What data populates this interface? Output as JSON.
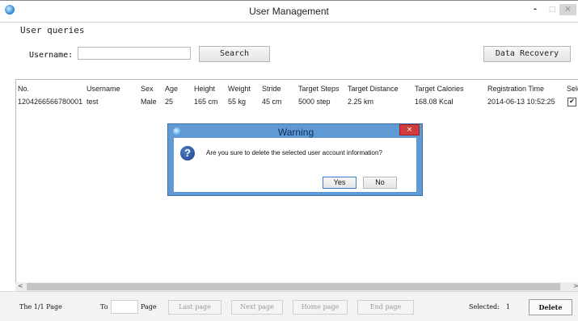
{
  "window": {
    "title": "User Management",
    "minimize_glyph": "-",
    "maximize_glyph": "□",
    "close_glyph": "×"
  },
  "query": {
    "group_label": "User queries",
    "username_label": "Username:",
    "username_value": "",
    "search_label": "Search",
    "data_recovery_label": "Data Recovery"
  },
  "table": {
    "columns": [
      "No.",
      "Username",
      "Sex",
      "Age",
      "Height",
      "Weight",
      "Stride",
      "Target Steps",
      "Target Distance",
      "Target Calories",
      "Registration Time",
      "Sele"
    ],
    "rows": [
      {
        "no": "1204266566780001",
        "username": "test",
        "sex": "Male",
        "age": "25",
        "height": "165 cm",
        "weight": "55 kg",
        "stride": "45 cm",
        "target_steps": "5000 step",
        "target_distance": "2.25 km",
        "target_calories": "168.08 Kcal",
        "registration_time": "2014-06-13 10:52:25",
        "selected": true
      }
    ]
  },
  "scrollbar": {
    "left_arrow": "<",
    "right_arrow": ">"
  },
  "footer": {
    "page_info": "The 1/1 Page",
    "to_label": "To",
    "page_label": "Page",
    "last_page": "Last page",
    "next_page": "Next page",
    "home_page": "Home page",
    "end_page": "End page",
    "selected_label": "Selected:",
    "selected_count": "1",
    "delete_label": "Delete"
  },
  "dialog": {
    "title": "Warning",
    "close_glyph": "×",
    "question_glyph": "?",
    "message": "Are you sure to delete the selected user account information?",
    "yes_label": "Yes",
    "no_label": "No"
  },
  "colors": {
    "dialog_frame": "#5f9ad4",
    "dialog_close": "#d03b3b",
    "question_icon": "#1c3f86"
  },
  "icons": {
    "app": "app-globe-icon",
    "dialog": "dialog-app-icon",
    "question": "question-icon",
    "checkbox": "checkbox-checked-icon"
  }
}
